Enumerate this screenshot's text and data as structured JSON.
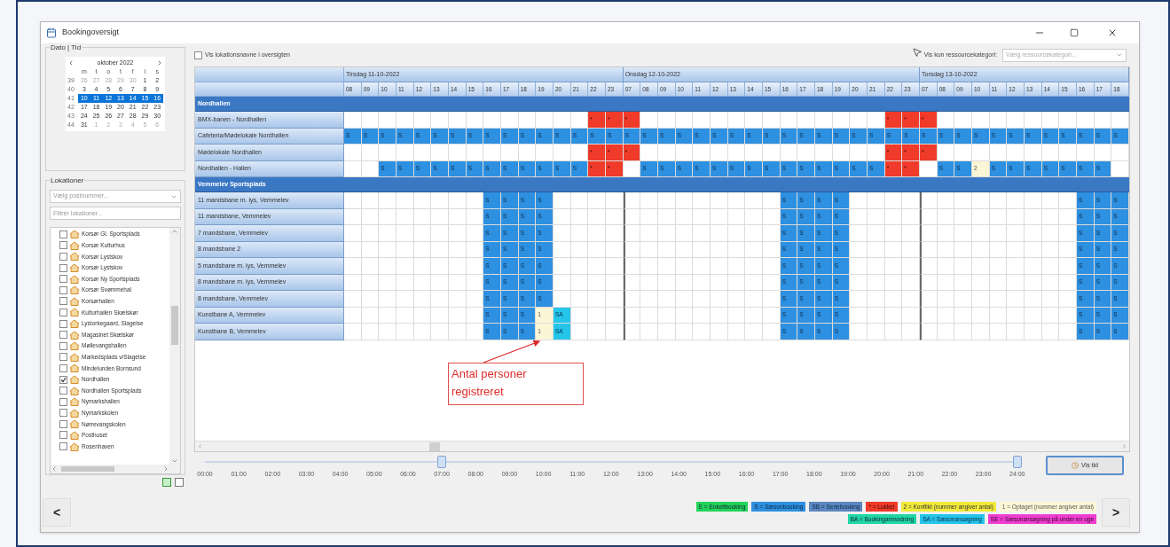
{
  "window": {
    "title": "Bookingoversigt"
  },
  "date_panel": {
    "title": "Dato | Tid",
    "calendar": {
      "month": "oktober 2022",
      "weekdays": [
        "m",
        "t",
        "o",
        "t",
        "f",
        "l",
        "s"
      ],
      "weeks": [
        {
          "number": "39",
          "selected": false,
          "days": [
            {
              "text": "26",
              "other_month": true
            },
            {
              "text": "27",
              "other_month": true
            },
            {
              "text": "28",
              "other_month": true
            },
            {
              "text": "29",
              "other_month": true
            },
            {
              "text": "30",
              "other_month": true
            },
            {
              "text": "1",
              "other_month": false
            },
            {
              "text": "2",
              "other_month": false
            }
          ]
        },
        {
          "number": "40",
          "selected": false,
          "days": [
            {
              "text": "3",
              "other_month": false
            },
            {
              "text": "4",
              "other_month": false
            },
            {
              "text": "5",
              "other_month": false
            },
            {
              "text": "6",
              "other_month": false
            },
            {
              "text": "7",
              "other_month": false
            },
            {
              "text": "8",
              "other_month": false
            },
            {
              "text": "9",
              "other_month": false
            }
          ]
        },
        {
          "number": "41",
          "selected": true,
          "days": [
            {
              "text": "10",
              "other_month": false
            },
            {
              "text": "11",
              "other_month": false
            },
            {
              "text": "12",
              "other_month": false
            },
            {
              "text": "13",
              "other_month": false
            },
            {
              "text": "14",
              "other_month": false
            },
            {
              "text": "15",
              "other_month": false
            },
            {
              "text": "16",
              "other_month": false
            }
          ]
        },
        {
          "number": "42",
          "selected": false,
          "days": [
            {
              "text": "17",
              "other_month": false
            },
            {
              "text": "18",
              "other_month": false
            },
            {
              "text": "19",
              "other_month": false
            },
            {
              "text": "20",
              "other_month": false
            },
            {
              "text": "21",
              "other_month": false
            },
            {
              "text": "22",
              "other_month": false
            },
            {
              "text": "23",
              "other_month": false
            }
          ]
        },
        {
          "number": "43",
          "selected": false,
          "days": [
            {
              "text": "24",
              "other_month": false
            },
            {
              "text": "25",
              "other_month": false
            },
            {
              "text": "26",
              "other_month": false
            },
            {
              "text": "27",
              "other_month": false
            },
            {
              "text": "28",
              "other_month": false
            },
            {
              "text": "29",
              "other_month": false
            },
            {
              "text": "30",
              "other_month": false
            }
          ]
        },
        {
          "number": "44",
          "selected": false,
          "days": [
            {
              "text": "31",
              "other_month": false
            },
            {
              "text": "1",
              "other_month": true
            },
            {
              "text": "2",
              "other_month": true
            },
            {
              "text": "3",
              "other_month": true
            },
            {
              "text": "4",
              "other_month": true
            },
            {
              "text": "5",
              "other_month": true
            },
            {
              "text": "6",
              "other_month": true
            }
          ]
        }
      ]
    }
  },
  "locations_panel": {
    "title": "Lokationer",
    "postcode_dropdown": {
      "placeholder": "Vælg postnummer..."
    },
    "filter_field": {
      "placeholder": "Filtrér lokationer..."
    },
    "items": [
      {
        "label": "Korsør Gl. Sportsplads",
        "checked": false
      },
      {
        "label": "Korsør Kulturhus",
        "checked": false
      },
      {
        "label": "Korsør Lystskov",
        "checked": false
      },
      {
        "label": "Korsør Lystskov",
        "checked": false
      },
      {
        "label": "Korsør Ny Sportsplads",
        "checked": false
      },
      {
        "label": "Korsør Svømmehal",
        "checked": false
      },
      {
        "label": "Korsørhallen",
        "checked": false
      },
      {
        "label": "Kulturhallen Skælskør",
        "checked": false
      },
      {
        "label": "Lystorkegaard, Slagelse",
        "checked": false
      },
      {
        "label": "Magasinet Skælskør",
        "checked": false
      },
      {
        "label": "Møllevangshallen",
        "checked": false
      },
      {
        "label": "Markedsplads v/Slagelse",
        "checked": false
      },
      {
        "label": "Mindelunden Bornsund",
        "checked": false
      },
      {
        "label": "Nordhallen",
        "checked": true
      },
      {
        "label": "Nordhallen Sportsplads",
        "checked": false
      },
      {
        "label": "Nymarkshallen",
        "checked": false
      },
      {
        "label": "Nymarkskolen",
        "checked": false
      },
      {
        "label": "Nørrevangskolen",
        "checked": false
      },
      {
        "label": "Posthuset",
        "checked": false
      },
      {
        "label": "Rosenhaven",
        "checked": false
      }
    ]
  },
  "show_names_checkbox": {
    "label": "Vis lokationsnavne i oversigten",
    "checked": false
  },
  "category_filter": {
    "label": "Vis kun ressourcekategori:",
    "placeholder": "Vælg ressourcekategori..."
  },
  "schedule": {
    "days": [
      {
        "title": "Tirsdag 11-10-2022",
        "hours": [
          "08",
          "09",
          "10",
          "11",
          "12",
          "13",
          "14",
          "15",
          "16",
          "17",
          "18",
          "19",
          "20",
          "21",
          "22",
          "23"
        ]
      },
      {
        "title": "Onsdag 12-10-2022",
        "hours": [
          "07",
          "08",
          "09",
          "10",
          "11",
          "12",
          "13",
          "14",
          "15",
          "16",
          "17",
          "18",
          "19",
          "20",
          "21",
          "22",
          "23"
        ]
      },
      {
        "title": "Torsdag 13-10-2022",
        "hours": [
          "07",
          "08",
          "09",
          "10",
          "11",
          "12",
          "13",
          "14",
          "15",
          "16",
          "17",
          "18"
        ]
      }
    ],
    "groups": [
      {
        "name": "Nordhallen",
        "rows": [
          {
            "name": "BMX-banen - Nordhallen",
            "cells": [
              null,
              null,
              null,
              null,
              null,
              null,
              null,
              null,
              null,
              null,
              null,
              null,
              null,
              null,
              {
                "kind": "closed",
                "text": "*"
              },
              {
                "kind": "closed",
                "text": "*"
              },
              {
                "kind": "closed",
                "text": "*"
              },
              null,
              null,
              null,
              null,
              null,
              null,
              null,
              null,
              null,
              null,
              null,
              null,
              null,
              null,
              {
                "kind": "closed",
                "text": "*"
              },
              {
                "kind": "closed",
                "text": "*"
              },
              {
                "kind": "closed",
                "text": "*"
              },
              null,
              null,
              null,
              null,
              null,
              null,
              null,
              null,
              null,
              null,
              null
            ]
          },
          {
            "name": "Cafeteria/Mødelokale Nordhallen",
            "cells": [
              {
                "kind": "season",
                "text": "S"
              },
              {
                "kind": "season",
                "text": "S"
              },
              {
                "kind": "season",
                "text": "S"
              },
              {
                "kind": "season",
                "text": "S"
              },
              {
                "kind": "season",
                "text": "S"
              },
              {
                "kind": "season",
                "text": "S"
              },
              {
                "kind": "season",
                "text": "S"
              },
              {
                "kind": "season",
                "text": "S"
              },
              {
                "kind": "season",
                "text": "S"
              },
              {
                "kind": "season",
                "text": "S"
              },
              {
                "kind": "season",
                "text": "S"
              },
              {
                "kind": "season",
                "text": "S"
              },
              {
                "kind": "season",
                "text": "S"
              },
              {
                "kind": "season",
                "text": "S"
              },
              {
                "kind": "season",
                "text": "S"
              },
              {
                "kind": "season",
                "text": "S"
              },
              {
                "kind": "season",
                "text": "S"
              },
              {
                "kind": "season",
                "text": "S"
              },
              {
                "kind": "season",
                "text": "S"
              },
              {
                "kind": "season",
                "text": "S"
              },
              {
                "kind": "season",
                "text": "S"
              },
              {
                "kind": "season",
                "text": "S"
              },
              {
                "kind": "season",
                "text": "S"
              },
              {
                "kind": "season",
                "text": "S"
              },
              {
                "kind": "season",
                "text": "S"
              },
              {
                "kind": "season",
                "text": "S"
              },
              {
                "kind": "season",
                "text": "S"
              },
              {
                "kind": "season",
                "text": "S"
              },
              {
                "kind": "season",
                "text": "S"
              },
              {
                "kind": "season",
                "text": "S"
              },
              {
                "kind": "season",
                "text": "S"
              },
              {
                "kind": "season",
                "text": "S"
              },
              {
                "kind": "season",
                "text": "S"
              },
              {
                "kind": "season",
                "text": "S"
              },
              {
                "kind": "season",
                "text": "S"
              },
              {
                "kind": "season",
                "text": "S"
              },
              {
                "kind": "season",
                "text": "S"
              },
              {
                "kind": "season",
                "text": "S"
              },
              {
                "kind": "season",
                "text": "S"
              },
              {
                "kind": "season",
                "text": "S"
              },
              {
                "kind": "season",
                "text": "S"
              },
              {
                "kind": "season",
                "text": "S"
              },
              {
                "kind": "season",
                "text": "S"
              },
              {
                "kind": "season",
                "text": "S"
              },
              {
                "kind": "season",
                "text": "S"
              }
            ]
          },
          {
            "name": "Mødelokale Nordhallen",
            "cells": [
              null,
              null,
              null,
              null,
              null,
              null,
              null,
              null,
              null,
              null,
              null,
              null,
              null,
              null,
              {
                "kind": "closed",
                "text": "*"
              },
              {
                "kind": "closed",
                "text": "*"
              },
              {
                "kind": "closed",
                "text": "*"
              },
              null,
              null,
              null,
              null,
              null,
              null,
              null,
              null,
              null,
              null,
              null,
              null,
              null,
              null,
              {
                "kind": "closed",
                "text": "*"
              },
              {
                "kind": "closed",
                "text": "*"
              },
              {
                "kind": "closed",
                "text": "*"
              },
              null,
              null,
              null,
              null,
              null,
              null,
              null,
              null,
              null,
              null,
              null
            ]
          },
          {
            "name": "Nordhallen - Hallen",
            "cells": [
              null,
              null,
              {
                "kind": "season",
                "text": "S"
              },
              {
                "kind": "season",
                "text": "S"
              },
              {
                "kind": "season",
                "text": "S"
              },
              {
                "kind": "season",
                "text": "S"
              },
              {
                "kind": "season",
                "text": "S"
              },
              {
                "kind": "season",
                "text": "S"
              },
              {
                "kind": "season",
                "text": "S"
              },
              {
                "kind": "season",
                "text": "S"
              },
              {
                "kind": "season",
                "text": "S"
              },
              {
                "kind": "season",
                "text": "S"
              },
              {
                "kind": "season",
                "text": "S"
              },
              {
                "kind": "season",
                "text": "S"
              },
              {
                "kind": "closed",
                "text": "*"
              },
              {
                "kind": "closed",
                "text": "*"
              },
              null,
              {
                "kind": "season",
                "text": "S"
              },
              {
                "kind": "season",
                "text": "S"
              },
              {
                "kind": "season",
                "text": "S"
              },
              {
                "kind": "season",
                "text": "S"
              },
              {
                "kind": "season",
                "text": "S"
              },
              {
                "kind": "season",
                "text": "S"
              },
              {
                "kind": "season",
                "text": "S"
              },
              {
                "kind": "season",
                "text": "S"
              },
              {
                "kind": "season",
                "text": "S"
              },
              {
                "kind": "season",
                "text": "S"
              },
              {
                "kind": "season",
                "text": "S"
              },
              {
                "kind": "season",
                "text": "S"
              },
              {
                "kind": "season",
                "text": "S"
              },
              {
                "kind": "season",
                "text": "S"
              },
              {
                "kind": "closed",
                "text": "*"
              },
              {
                "kind": "closed",
                "text": "*"
              },
              null,
              {
                "kind": "season",
                "text": "S"
              },
              {
                "kind": "season",
                "text": "S"
              },
              {
                "kind": "occupied",
                "text": "2"
              },
              {
                "kind": "season",
                "text": "S"
              },
              {
                "kind": "season",
                "text": "S"
              },
              {
                "kind": "season",
                "text": "S"
              },
              {
                "kind": "season",
                "text": "S"
              },
              {
                "kind": "season",
                "text": "S"
              },
              {
                "kind": "season",
                "text": "S"
              },
              {
                "kind": "season",
                "text": "S"
              },
              null
            ]
          }
        ]
      },
      {
        "name": "Vemmelev Sportsplads",
        "rows": [
          {
            "name": "11 mandsbane m. lys, Vemmelev",
            "cells": [
              null,
              null,
              null,
              null,
              null,
              null,
              null,
              null,
              {
                "kind": "season",
                "text": "S"
              },
              {
                "kind": "season",
                "text": "S"
              },
              {
                "kind": "season",
                "text": "S"
              },
              {
                "kind": "season",
                "text": "S"
              },
              null,
              null,
              null,
              null,
              null,
              null,
              null,
              null,
              null,
              null,
              null,
              null,
              null,
              {
                "kind": "season",
                "text": "S"
              },
              {
                "kind": "season",
                "text": "S"
              },
              {
                "kind": "season",
                "text": "S"
              },
              {
                "kind": "season",
                "text": "S"
              },
              null,
              null,
              null,
              null,
              null,
              null,
              null,
              null,
              null,
              null,
              null,
              null,
              null,
              {
                "kind": "season",
                "text": "S"
              },
              {
                "kind": "season",
                "text": "S"
              },
              {
                "kind": "season",
                "text": "S"
              }
            ]
          },
          {
            "name": "11 mandsbane, Vemmelev",
            "cells": [
              null,
              null,
              null,
              null,
              null,
              null,
              null,
              null,
              {
                "kind": "season",
                "text": "S"
              },
              {
                "kind": "season",
                "text": "S"
              },
              {
                "kind": "season",
                "text": "S"
              },
              {
                "kind": "season",
                "text": "S"
              },
              null,
              null,
              null,
              null,
              null,
              null,
              null,
              null,
              null,
              null,
              null,
              null,
              null,
              {
                "kind": "season",
                "text": "S"
              },
              {
                "kind": "season",
                "text": "S"
              },
              {
                "kind": "season",
                "text": "S"
              },
              {
                "kind": "season",
                "text": "S"
              },
              null,
              null,
              null,
              null,
              null,
              null,
              null,
              null,
              null,
              null,
              null,
              null,
              null,
              {
                "kind": "season",
                "text": "S"
              },
              {
                "kind": "season",
                "text": "S"
              },
              {
                "kind": "season",
                "text": "S"
              }
            ]
          },
          {
            "name": "7 mandsbane, Vemmelev",
            "cells": [
              null,
              null,
              null,
              null,
              null,
              null,
              null,
              null,
              {
                "kind": "season",
                "text": "S"
              },
              {
                "kind": "season",
                "text": "S"
              },
              {
                "kind": "season",
                "text": "S"
              },
              {
                "kind": "season",
                "text": "S"
              },
              null,
              null,
              null,
              null,
              null,
              null,
              null,
              null,
              null,
              null,
              null,
              null,
              null,
              {
                "kind": "season",
                "text": "S"
              },
              {
                "kind": "season",
                "text": "S"
              },
              {
                "kind": "season",
                "text": "S"
              },
              {
                "kind": "season",
                "text": "S"
              },
              null,
              null,
              null,
              null,
              null,
              null,
              null,
              null,
              null,
              null,
              null,
              null,
              null,
              {
                "kind": "season",
                "text": "S"
              },
              {
                "kind": "season",
                "text": "S"
              },
              {
                "kind": "season",
                "text": "S"
              }
            ]
          },
          {
            "name": "8 mandsbane 2",
            "cells": [
              null,
              null,
              null,
              null,
              null,
              null,
              null,
              null,
              {
                "kind": "season",
                "text": "S"
              },
              {
                "kind": "season",
                "text": "S"
              },
              {
                "kind": "season",
                "text": "S"
              },
              {
                "kind": "season",
                "text": "S"
              },
              null,
              null,
              null,
              null,
              null,
              null,
              null,
              null,
              null,
              null,
              null,
              null,
              null,
              {
                "kind": "season",
                "text": "S"
              },
              {
                "kind": "season",
                "text": "S"
              },
              {
                "kind": "season",
                "text": "S"
              },
              {
                "kind": "season",
                "text": "S"
              },
              null,
              null,
              null,
              null,
              null,
              null,
              null,
              null,
              null,
              null,
              null,
              null,
              null,
              {
                "kind": "season",
                "text": "S"
              },
              {
                "kind": "season",
                "text": "S"
              },
              {
                "kind": "season",
                "text": "S"
              }
            ]
          },
          {
            "name": "5 mandsbane m. lys, Vemmelev",
            "cells": [
              null,
              null,
              null,
              null,
              null,
              null,
              null,
              null,
              {
                "kind": "season",
                "text": "S"
              },
              {
                "kind": "season",
                "text": "S"
              },
              {
                "kind": "season",
                "text": "S"
              },
              {
                "kind": "season",
                "text": "S"
              },
              null,
              null,
              null,
              null,
              null,
              null,
              null,
              null,
              null,
              null,
              null,
              null,
              null,
              {
                "kind": "season",
                "text": "S"
              },
              {
                "kind": "season",
                "text": "S"
              },
              {
                "kind": "season",
                "text": "S"
              },
              {
                "kind": "season",
                "text": "S"
              },
              null,
              null,
              null,
              null,
              null,
              null,
              null,
              null,
              null,
              null,
              null,
              null,
              null,
              {
                "kind": "season",
                "text": "S"
              },
              {
                "kind": "season",
                "text": "S"
              },
              {
                "kind": "season",
                "text": "S"
              }
            ]
          },
          {
            "name": "8 mandsbane m. lys, Vemmelev",
            "cells": [
              null,
              null,
              null,
              null,
              null,
              null,
              null,
              null,
              {
                "kind": "season",
                "text": "S"
              },
              {
                "kind": "season",
                "text": "S"
              },
              {
                "kind": "season",
                "text": "S"
              },
              {
                "kind": "season",
                "text": "S"
              },
              null,
              null,
              null,
              null,
              null,
              null,
              null,
              null,
              null,
              null,
              null,
              null,
              null,
              {
                "kind": "season",
                "text": "S"
              },
              {
                "kind": "season",
                "text": "S"
              },
              {
                "kind": "season",
                "text": "S"
              },
              {
                "kind": "season",
                "text": "S"
              },
              null,
              null,
              null,
              null,
              null,
              null,
              null,
              null,
              null,
              null,
              null,
              null,
              null,
              {
                "kind": "season",
                "text": "S"
              },
              {
                "kind": "season",
                "text": "S"
              },
              {
                "kind": "season",
                "text": "S"
              }
            ]
          },
          {
            "name": "8 mandsbane, Vemmelev",
            "cells": [
              null,
              null,
              null,
              null,
              null,
              null,
              null,
              null,
              {
                "kind": "season",
                "text": "S"
              },
              {
                "kind": "season",
                "text": "S"
              },
              {
                "kind": "season",
                "text": "S"
              },
              {
                "kind": "season",
                "text": "S"
              },
              null,
              null,
              null,
              null,
              null,
              null,
              null,
              null,
              null,
              null,
              null,
              null,
              null,
              {
                "kind": "season",
                "text": "S"
              },
              {
                "kind": "season",
                "text": "S"
              },
              {
                "kind": "season",
                "text": "S"
              },
              {
                "kind": "season",
                "text": "S"
              },
              null,
              null,
              null,
              null,
              null,
              null,
              null,
              null,
              null,
              null,
              null,
              null,
              null,
              {
                "kind": "season",
                "text": "S"
              },
              {
                "kind": "season",
                "text": "S"
              },
              {
                "kind": "season",
                "text": "S"
              }
            ]
          },
          {
            "name": "Kunstbane A, Vemmelev",
            "cells": [
              null,
              null,
              null,
              null,
              null,
              null,
              null,
              null,
              {
                "kind": "season",
                "text": "S"
              },
              {
                "kind": "season",
                "text": "S"
              },
              {
                "kind": "season",
                "text": "S"
              },
              {
                "kind": "occupied",
                "text": "1"
              },
              {
                "kind": "season_application",
                "text": "SA"
              },
              null,
              null,
              null,
              null,
              null,
              null,
              null,
              null,
              null,
              null,
              null,
              null,
              {
                "kind": "season",
                "text": "S"
              },
              {
                "kind": "season",
                "text": "S"
              },
              {
                "kind": "season",
                "text": "S"
              },
              {
                "kind": "season",
                "text": "S"
              },
              null,
              null,
              null,
              null,
              null,
              null,
              null,
              null,
              null,
              null,
              null,
              null,
              null,
              {
                "kind": "season",
                "text": "S"
              },
              {
                "kind": "season",
                "text": "S"
              },
              {
                "kind": "season",
                "text": "S"
              }
            ]
          },
          {
            "name": "Kunstbane B, Vemmelev",
            "cells": [
              null,
              null,
              null,
              null,
              null,
              null,
              null,
              null,
              {
                "kind": "season",
                "text": "S"
              },
              {
                "kind": "season",
                "text": "S"
              },
              {
                "kind": "season",
                "text": "S"
              },
              {
                "kind": "occupied",
                "text": "1"
              },
              {
                "kind": "season_application",
                "text": "SA"
              },
              null,
              null,
              null,
              null,
              null,
              null,
              null,
              null,
              null,
              null,
              null,
              null,
              {
                "kind": "season",
                "text": "S"
              },
              {
                "kind": "season",
                "text": "S"
              },
              {
                "kind": "season",
                "text": "S"
              },
              {
                "kind": "season",
                "text": "S"
              },
              null,
              null,
              null,
              null,
              null,
              null,
              null,
              null,
              null,
              null,
              null,
              null,
              null,
              {
                "kind": "season",
                "text": "S"
              },
              {
                "kind": "season",
                "text": "S"
              },
              {
                "kind": "season",
                "text": "S"
              }
            ]
          }
        ]
      }
    ]
  },
  "annotation": {
    "text": "Antal personer registreret"
  },
  "time_slider": {
    "labels": [
      "00:00",
      "01:00",
      "02:00",
      "03:00",
      "04:00",
      "05:00",
      "06:00",
      "07:00",
      "08:00",
      "09:00",
      "10:00",
      "11:00",
      "12:00",
      "13:00",
      "14:00",
      "15:00",
      "16:00",
      "17:00",
      "18:00",
      "19:00",
      "20:00",
      "21:00",
      "22:00",
      "23:00",
      "24:00"
    ],
    "thumbs": [
      {
        "level": 0.2917
      },
      {
        "level": 1
      }
    ],
    "button": "Vis tid"
  },
  "legend": {
    "items": [
      {
        "kind": "single",
        "text": "E = Enkeltbooking"
      },
      {
        "kind": "season",
        "text": "S = Sæsonbooking"
      },
      {
        "kind": "series",
        "text": "SB = Seriebooking"
      },
      {
        "kind": "closed",
        "text": "* = Lukket"
      },
      {
        "kind": "conflict",
        "text": "2 = Konflikt (nummer angiver antal)"
      },
      {
        "kind": "occupied",
        "text": "1 = Optaget (nummer angiver antal)"
      },
      {
        "kind": "request",
        "text": "BA = Bookinganmodning"
      },
      {
        "kind": "season_application",
        "text": "SA = Sæsonansøgning"
      },
      {
        "kind": "season_application_short",
        "text": "SE = Sæsonansøgning på under en uge"
      }
    ]
  },
  "nav": {
    "previous": "<",
    "next": ">"
  }
}
